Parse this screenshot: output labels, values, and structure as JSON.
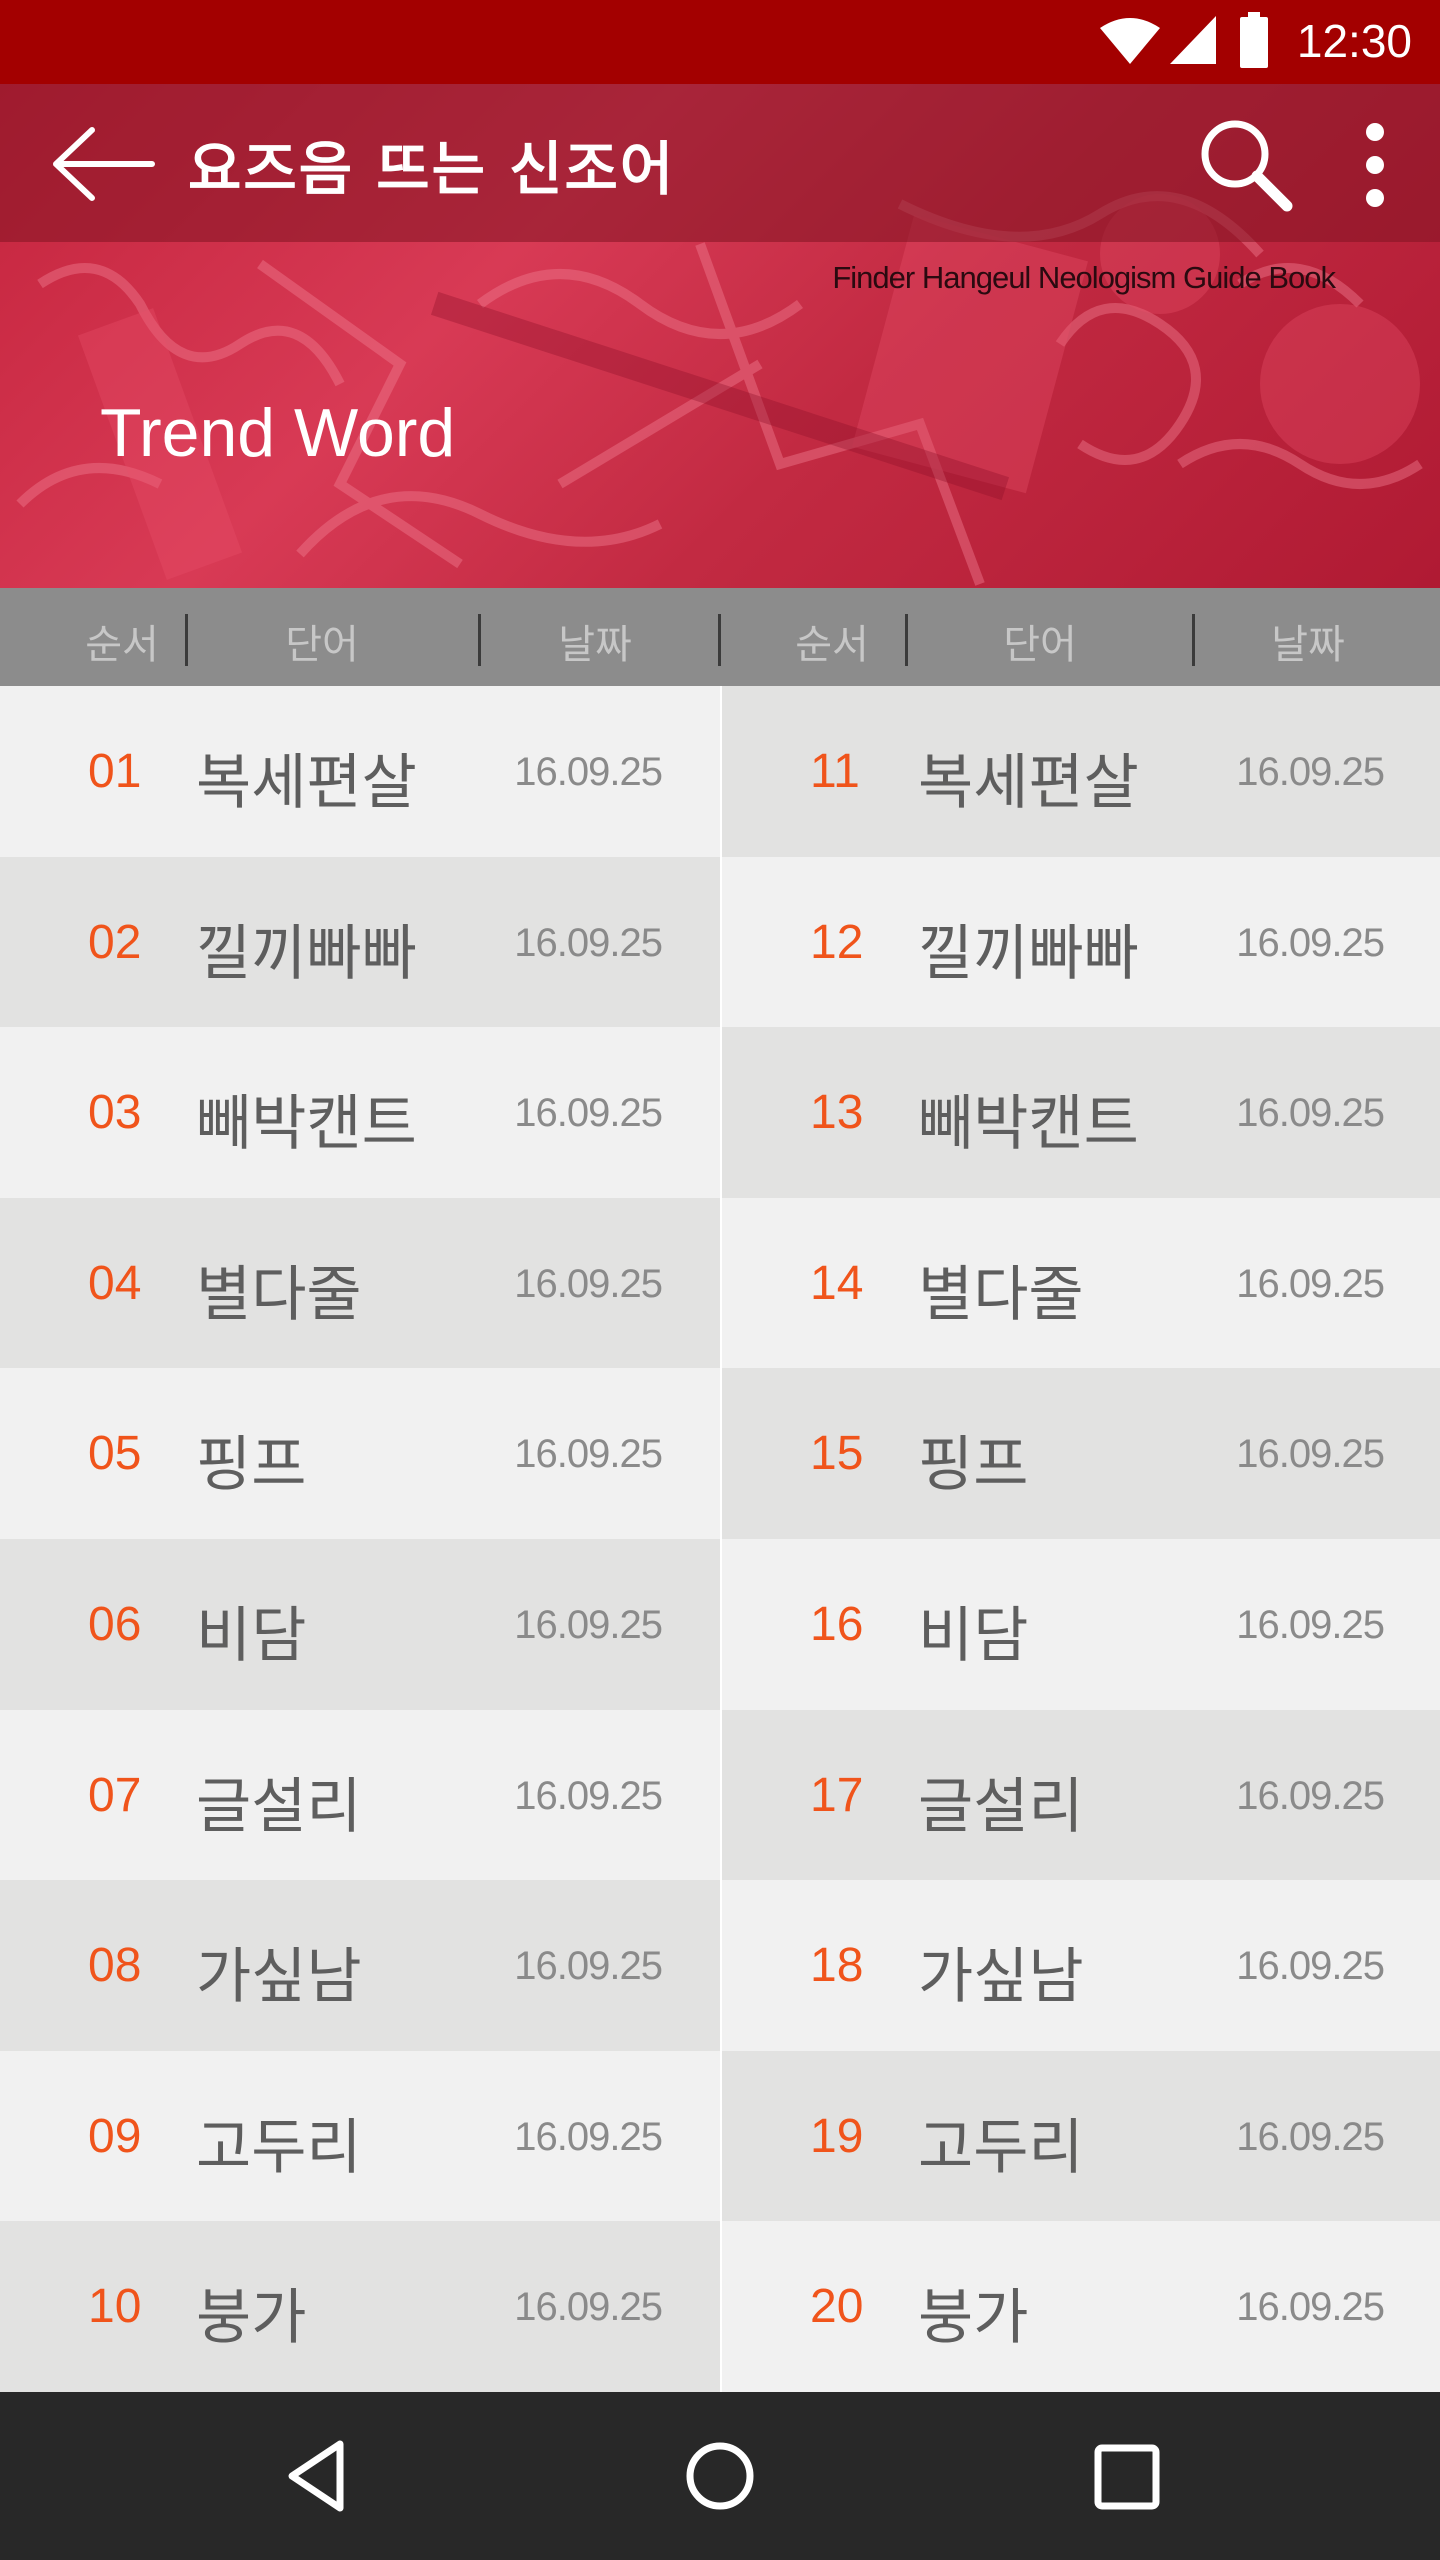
{
  "status": {
    "time": "12:30"
  },
  "toolbar": {
    "title": "요즈음 뜨는 신조어"
  },
  "header": {
    "book": "Finder Hangeul Neologism Guide Book",
    "heading": "Trend Word"
  },
  "columns": {
    "order": "순서",
    "word": "단어",
    "date": "날짜"
  },
  "left": [
    {
      "num": "01",
      "word": "복세편살",
      "date": "16.09.25"
    },
    {
      "num": "02",
      "word": "낄끼빠빠",
      "date": "16.09.25"
    },
    {
      "num": "03",
      "word": "빼박캔트",
      "date": "16.09.25"
    },
    {
      "num": "04",
      "word": "별다줄",
      "date": "16.09.25"
    },
    {
      "num": "05",
      "word": "핑프",
      "date": "16.09.25"
    },
    {
      "num": "06",
      "word": "비담",
      "date": "16.09.25"
    },
    {
      "num": "07",
      "word": "글설리",
      "date": "16.09.25"
    },
    {
      "num": "08",
      "word": "가싶남",
      "date": "16.09.25"
    },
    {
      "num": "09",
      "word": "고두리",
      "date": "16.09.25"
    },
    {
      "num": "10",
      "word": "붕가",
      "date": "16.09.25"
    }
  ],
  "right": [
    {
      "num": "11",
      "word": "복세편살",
      "date": "16.09.25"
    },
    {
      "num": "12",
      "word": "낄끼빠빠",
      "date": "16.09.25"
    },
    {
      "num": "13",
      "word": "빼박캔트",
      "date": "16.09.25"
    },
    {
      "num": "14",
      "word": "별다줄",
      "date": "16.09.25"
    },
    {
      "num": "15",
      "word": "핑프",
      "date": "16.09.25"
    },
    {
      "num": "16",
      "word": "비담",
      "date": "16.09.25"
    },
    {
      "num": "17",
      "word": "글설리",
      "date": "16.09.25"
    },
    {
      "num": "18",
      "word": "가싶남",
      "date": "16.09.25"
    },
    {
      "num": "19",
      "word": "고두리",
      "date": "16.09.25"
    },
    {
      "num": "20",
      "word": "붕가",
      "date": "16.09.25"
    }
  ],
  "colors": {
    "status": "#a30000",
    "accent": "#f0541b",
    "header": "#c4243d"
  },
  "icons": [
    "wifi-icon",
    "signal-icon",
    "battery-icon",
    "back-arrow-icon",
    "search-icon",
    "more-vert-icon",
    "nav-back-icon",
    "nav-home-icon",
    "nav-recents-icon"
  ]
}
